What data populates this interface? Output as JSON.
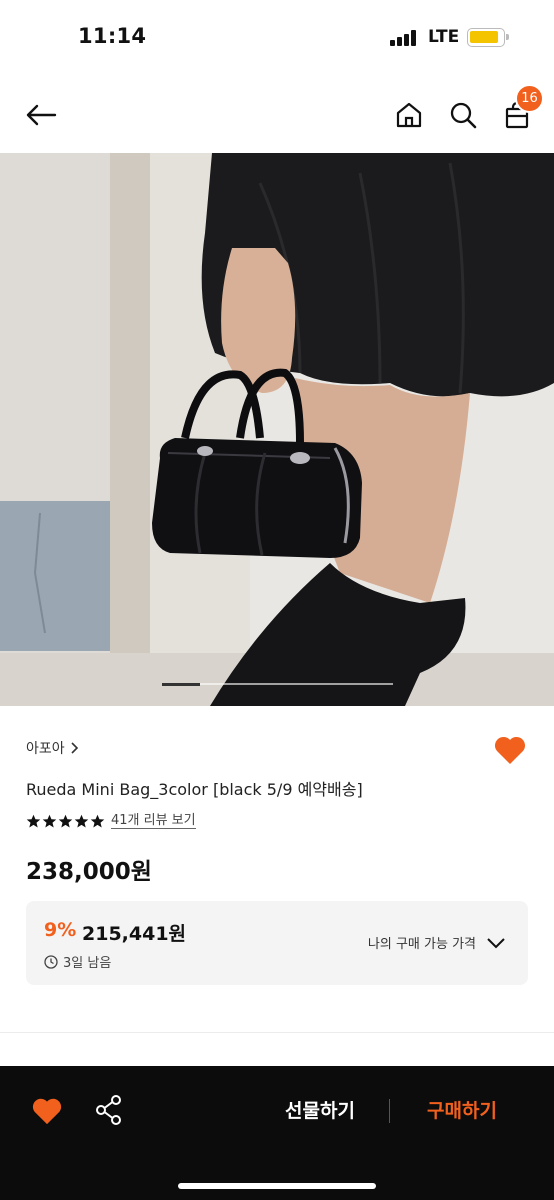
{
  "status": {
    "time": "11:14",
    "network": "LTE",
    "battery_color": "#f5c400"
  },
  "nav": {
    "cart_count": "16",
    "accent": "#f2601e"
  },
  "gallery": {
    "current_index": 1,
    "image_subject": "black leather mini boston bag held by hand"
  },
  "product": {
    "brand": "아포아",
    "name": "Rueda Mini Bag_3color [black 5/9 예약배송]",
    "rating_stars": 5,
    "review_link": "41개 리뷰 보기",
    "price": "238,000원"
  },
  "discount": {
    "rate": "9%",
    "price": "215,441원",
    "time_left": "3일 남음",
    "my_price_label": "나의 구매 가능 가격"
  },
  "bottom": {
    "gift_label": "선물하기",
    "buy_label": "구매하기"
  },
  "colors": {
    "accent": "#f2601e",
    "dark_bar": "#0c0c0c"
  }
}
